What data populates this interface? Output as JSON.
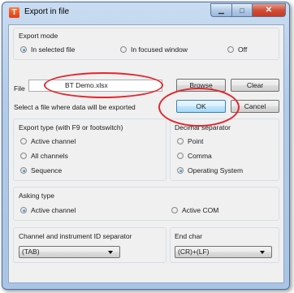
{
  "window": {
    "title": "Export in file",
    "app_icon_letter": "T",
    "controls": {
      "minimize": "▁",
      "maximize": "□",
      "close": "✕"
    }
  },
  "export_mode": {
    "label": "Export mode",
    "options": [
      {
        "label": "In selected file",
        "selected": true
      },
      {
        "label": "In focused window",
        "selected": false
      },
      {
        "label": "Off",
        "selected": false
      }
    ]
  },
  "file": {
    "label": "File",
    "value": "BT Demo.xlsx",
    "hint": "Select a file where data will be exported",
    "browse_label": "Browse",
    "clear_label": "Clear",
    "ok_label": "OK",
    "cancel_label": "Cancel"
  },
  "export_type": {
    "label": "Export type (with F9 or footswitch)",
    "options": [
      {
        "label": "Active channel",
        "selected": false
      },
      {
        "label": "All channels",
        "selected": false
      },
      {
        "label": "Sequence",
        "selected": true
      }
    ]
  },
  "decimal_separator": {
    "label": "Decimal separator",
    "options": [
      {
        "label": "Point",
        "selected": false
      },
      {
        "label": "Comma",
        "selected": false
      },
      {
        "label": "Operating System",
        "selected": true
      }
    ]
  },
  "asking_type": {
    "label": "Asking type",
    "options": [
      {
        "label": "Active channel",
        "selected": true
      },
      {
        "label": "Active COM",
        "selected": false
      }
    ]
  },
  "channel_separator": {
    "label": "Channel and instrument ID separator",
    "value": "(TAB)"
  },
  "end_char": {
    "label": "End char",
    "value": "(CR)+(LF)"
  },
  "colors": {
    "annotation": "#e3262e",
    "titlebar": "#b2cbe8",
    "selected_radio": "#1a5fb0"
  }
}
